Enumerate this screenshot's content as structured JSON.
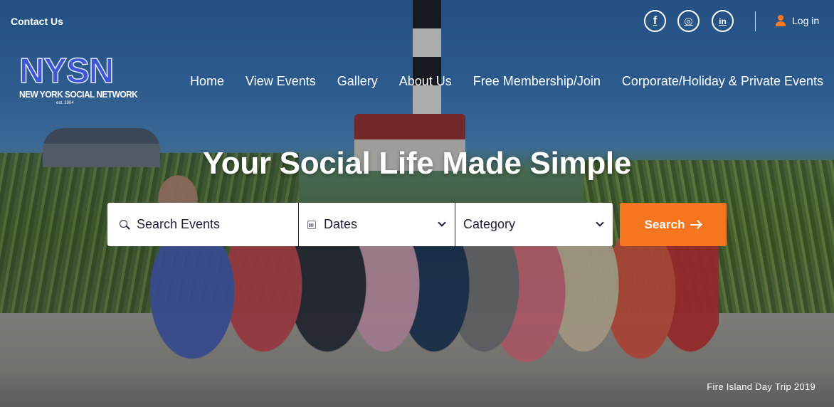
{
  "topbar": {
    "contact_label": "Contact Us",
    "social": [
      {
        "name": "facebook-icon",
        "glyph": "f"
      },
      {
        "name": "instagram-icon",
        "glyph": "◎"
      },
      {
        "name": "linkedin-icon",
        "glyph": "in"
      }
    ],
    "login_label": "Log in"
  },
  "logo": {
    "main": "NYSN",
    "sub": "NEW YORK SOCIAL NETWORK",
    "est": "est. 2004"
  },
  "nav": {
    "items": [
      "Home",
      "View Events",
      "Gallery",
      "About Us",
      "Free Membership/Join",
      "Corporate/Holiday & Private Events"
    ]
  },
  "hero": {
    "headline": "Your Social Life Made Simple",
    "caption": "Fire Island Day Trip 2019"
  },
  "search": {
    "events_placeholder": "Search Events",
    "dates_label": "Dates",
    "category_label": "Category",
    "button_label": "Search"
  },
  "colors": {
    "accent": "#f5761e",
    "logo_blue": "#3d55d8",
    "field_text": "#1b1f3b"
  }
}
